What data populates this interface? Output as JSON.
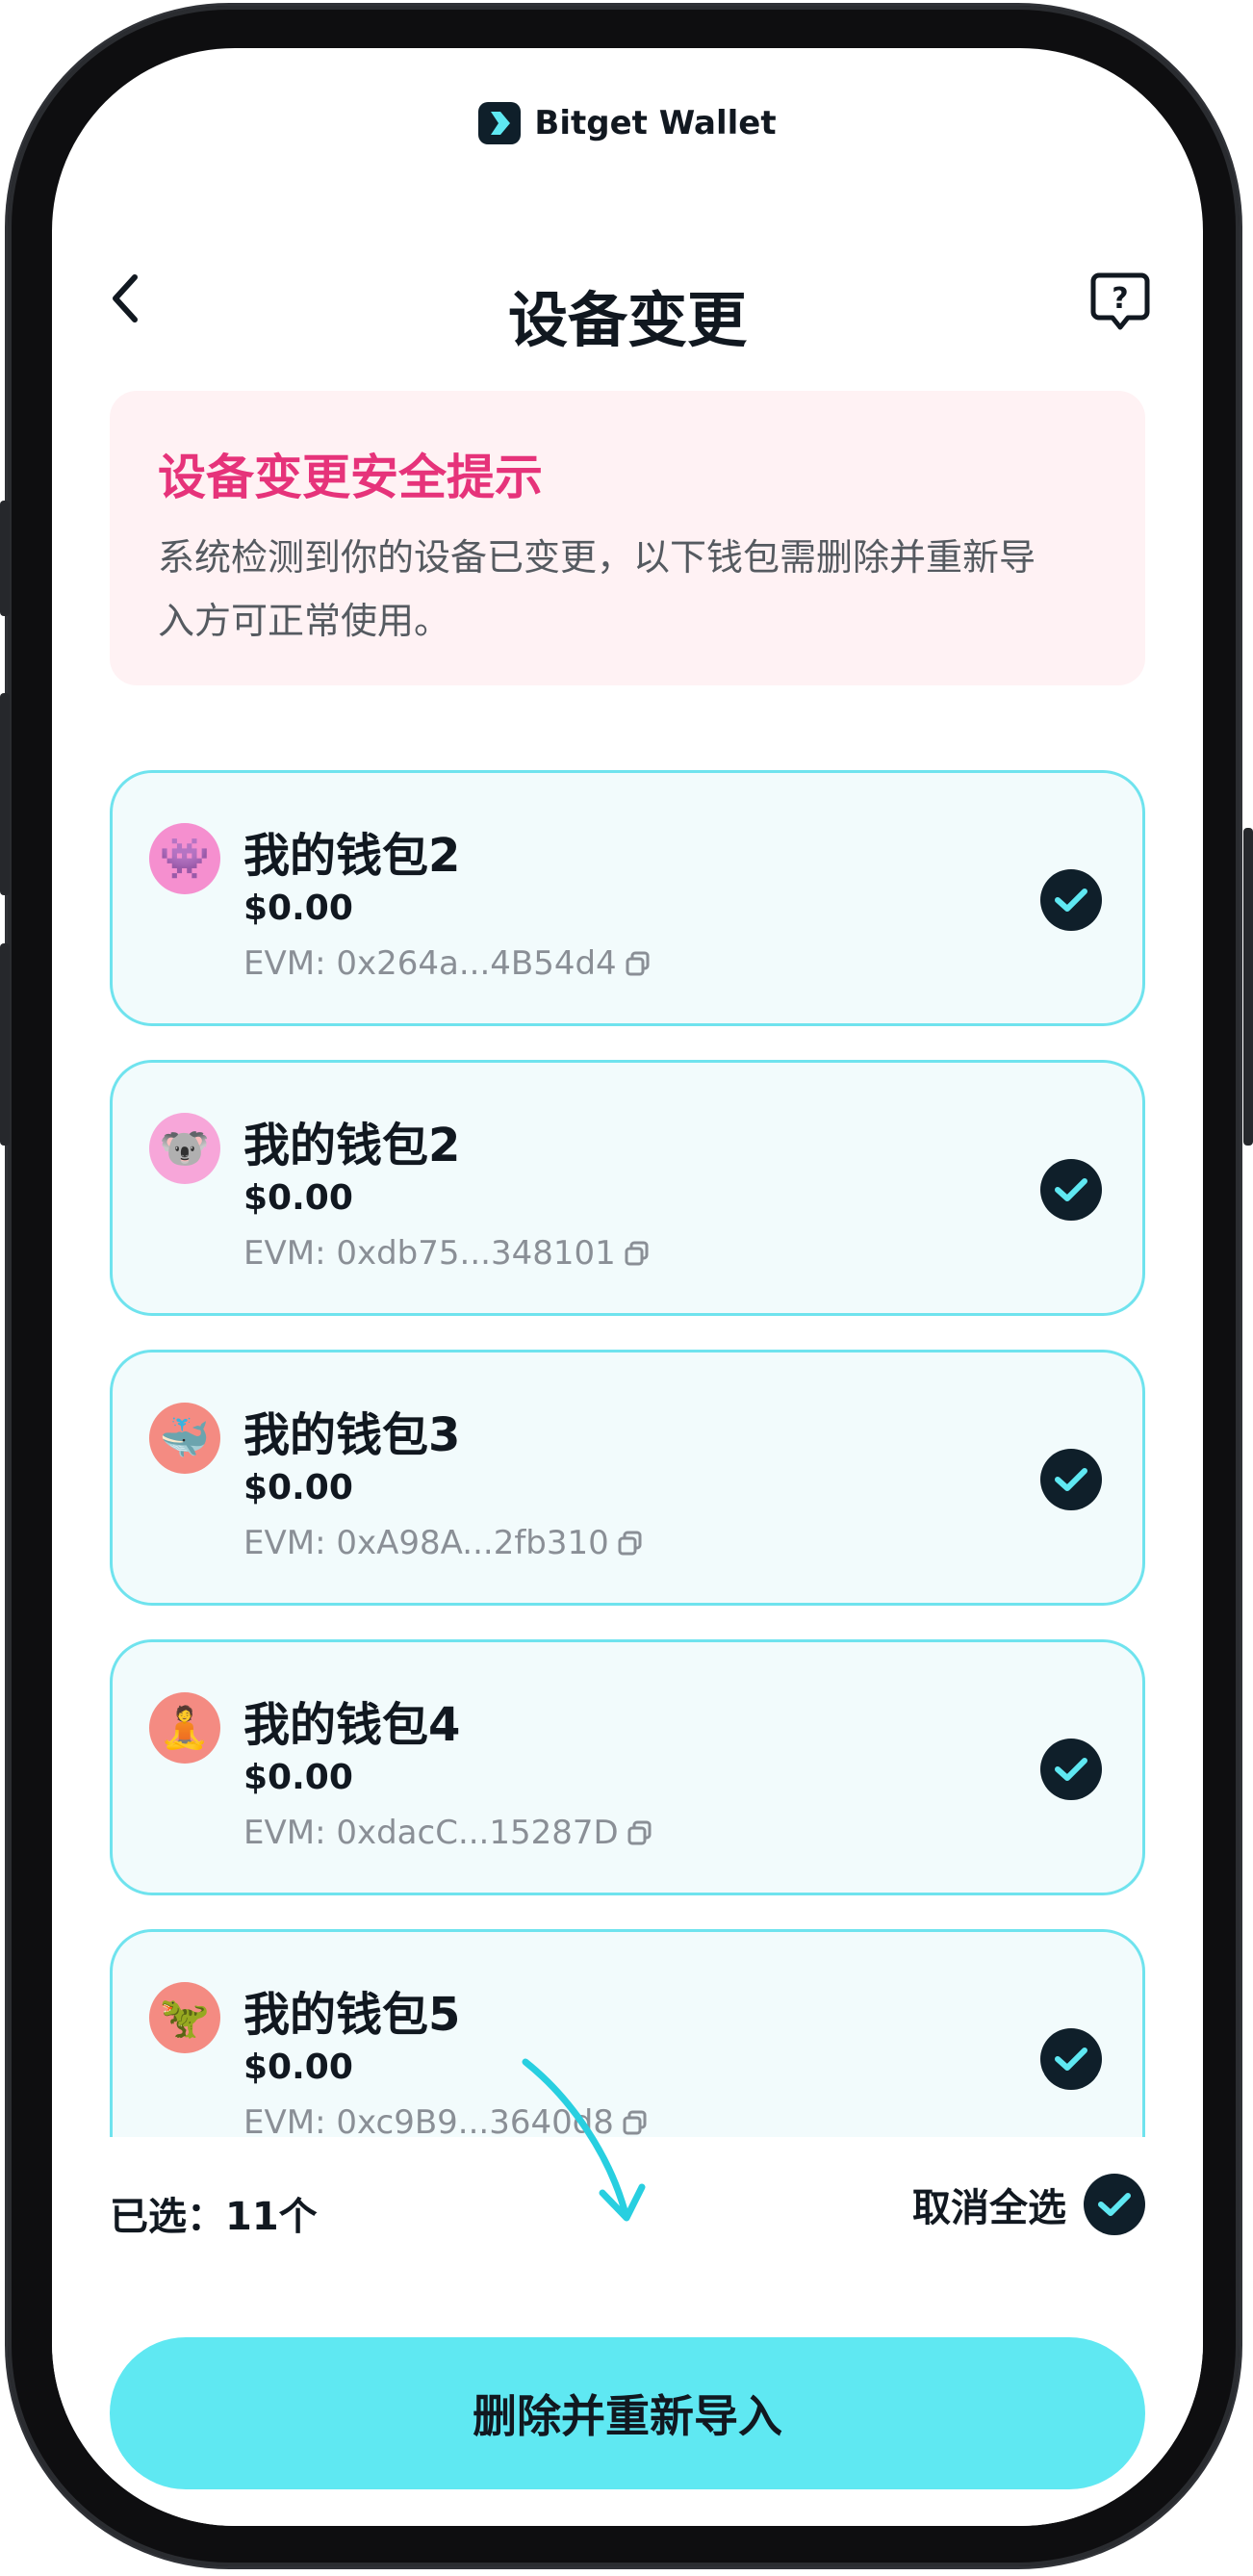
{
  "brand": {
    "name": "Bitget Wallet",
    "logo_icon": "bitget-chevron-icon"
  },
  "header": {
    "title": "设备变更",
    "back_icon": "chevron-left-icon",
    "help_icon": "help-chat-icon"
  },
  "notice": {
    "title": "设备变更安全提示",
    "body": "系统检测到你的设备已变更，以下钱包需删除并重新导入方可正常使用。"
  },
  "wallets": [
    {
      "name": "我的钱包2",
      "balance": "$0.00",
      "address": "EVM: 0x264a...4B54d4",
      "avatar": "pixel-invader-avatar",
      "avatar_bg": "#f58fcf",
      "avatar_glyph": "👾",
      "selected": true
    },
    {
      "name": "我的钱包2",
      "balance": "$0.00",
      "address": "EVM: 0xdb75...348101",
      "avatar": "koala-avatar",
      "avatar_bg": "#f7a6d9",
      "avatar_glyph": "🐨",
      "selected": true
    },
    {
      "name": "我的钱包3",
      "balance": "$0.00",
      "address": "EVM: 0xA98A...2fb310",
      "avatar": "whale-avatar",
      "avatar_bg": "#f48b82",
      "avatar_glyph": "🐳",
      "selected": true
    },
    {
      "name": "我的钱包4",
      "balance": "$0.00",
      "address": "EVM: 0xdacC...15287D",
      "avatar": "yoga-avatar",
      "avatar_bg": "#f48b82",
      "avatar_glyph": "🧘",
      "selected": true
    },
    {
      "name": "我的钱包5",
      "balance": "$0.00",
      "address": "EVM: 0xc9B9...3640d8",
      "avatar": "dinosaur-avatar",
      "avatar_bg": "#f48b82",
      "avatar_glyph": "🦖",
      "selected": true
    }
  ],
  "footer": {
    "selected_label": "已选：11个",
    "deselect_all_label": "取消全选",
    "primary_button": "删除并重新导入"
  },
  "colors": {
    "accent": "#5fe8f2",
    "notice_title": "#e6337a",
    "notice_bg": "#fff2f4",
    "card_border": "#6fe3ee",
    "card_bg": "#f2fbfc",
    "check_bg": "#0f1f2a",
    "annotation_arrow": "#28cfe0"
  }
}
